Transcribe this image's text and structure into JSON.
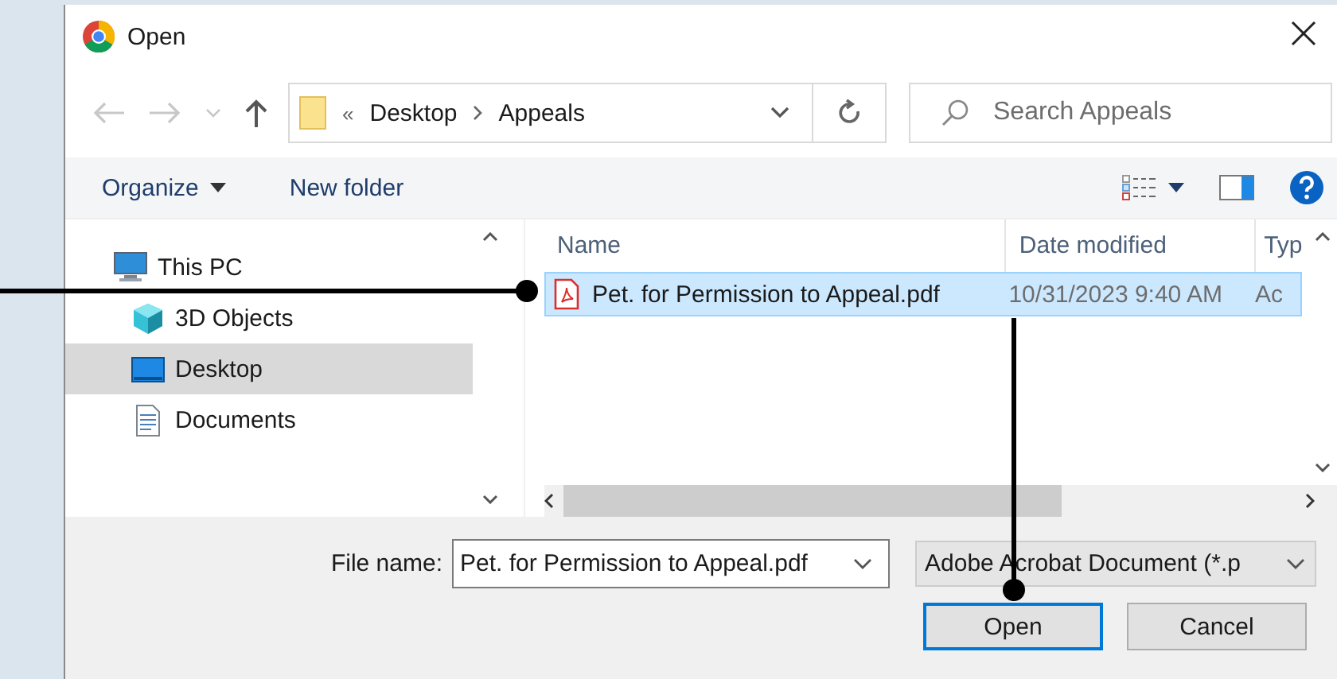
{
  "window": {
    "title": "Open"
  },
  "navigation": {
    "overflow_mark": "«",
    "breadcrumb": [
      "Desktop",
      "Appeals"
    ],
    "search": {
      "placeholder": "Search Appeals"
    }
  },
  "toolbar": {
    "buttons": [
      {
        "label": "Organize",
        "kind": "menu"
      },
      {
        "label": "New folder",
        "kind": "plain"
      }
    ]
  },
  "sidebar": {
    "items": [
      {
        "label": "This PC",
        "kind": "pc",
        "selected": false,
        "children": [
          {
            "label": "3D Objects",
            "kind": "objects",
            "selected": false
          },
          {
            "label": "Desktop",
            "kind": "desktop",
            "selected": true
          },
          {
            "label": "Documents",
            "kind": "documents",
            "selected": false
          }
        ]
      }
    ]
  },
  "file_list": {
    "columns": [
      "Name",
      "Date modified",
      "Typ"
    ],
    "rows": [
      {
        "cells": [
          "Pet. for Permission to Appeal.pdf",
          "10/31/2023 9:40 AM",
          "Ac"
        ],
        "selected": true
      }
    ]
  },
  "file_name": {
    "label": "File name:",
    "value": "Pet. for Permission to Appeal.pdf"
  },
  "file_type": {
    "value": "Adobe Acrobat Document (*.p"
  },
  "buttons": [
    {
      "label": "Open",
      "default": true
    },
    {
      "label": "Cancel",
      "default": false
    }
  ]
}
